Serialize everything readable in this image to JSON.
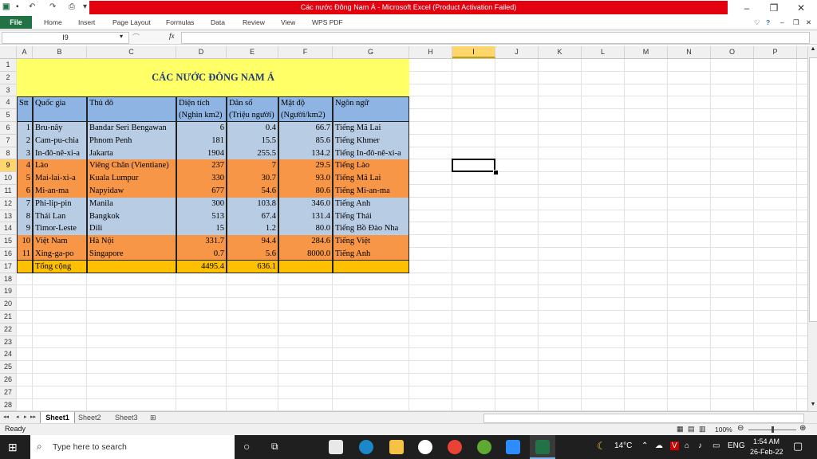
{
  "title_bar": {
    "title": "Các nước Đông Nam Á  -  Microsoft Excel (Product Activation Failed)"
  },
  "ribbon_tabs": [
    "File",
    "Home",
    "Insert",
    "Page Layout",
    "Formulas",
    "Data",
    "Review",
    "View",
    "WPS PDF"
  ],
  "formula_bar": {
    "name_box": "I9",
    "fx": "fx",
    "formula": ""
  },
  "columns": [
    "A",
    "B",
    "C",
    "D",
    "E",
    "F",
    "G",
    "H",
    "I",
    "J",
    "K",
    "L",
    "M",
    "N",
    "O",
    "P"
  ],
  "rows": [
    "1",
    "2",
    "3",
    "4",
    "5",
    "6",
    "7",
    "8",
    "9",
    "10",
    "11",
    "12",
    "13",
    "14",
    "15",
    "16",
    "17",
    "18",
    "19",
    "20",
    "21",
    "22",
    "23",
    "24",
    "25",
    "26",
    "27",
    "28"
  ],
  "selected_cell": {
    "column": "I",
    "row": "9"
  },
  "table": {
    "title": "CÁC NƯỚC ĐÔNG NAM Á",
    "headers": {
      "stt": "Stt",
      "country": "Quốc gia",
      "capital": "Thủ đô",
      "area_1": "Diện tích",
      "area_2": "(Nghìn km2)",
      "pop_1": "Dân số",
      "pop_2": "(Triệu người)",
      "density_1": "Mật độ",
      "density_2": "(Người/km2)",
      "language": "Ngôn ngữ"
    },
    "rows": [
      {
        "stt": "1",
        "country": "Bru-nây",
        "capital": "Bandar Seri Bengawan",
        "area": "6",
        "pop": "0.4",
        "density": "66.7",
        "language": "Tiếng Mã Lai",
        "color": "#b8cce4"
      },
      {
        "stt": "2",
        "country": "Cam-pu-chia",
        "capital": "Phnom Penh",
        "area": "181",
        "pop": "15.5",
        "density": "85.6",
        "language": "Tiếng Khmer",
        "color": "#b8cce4"
      },
      {
        "stt": "3",
        "country": "In-đô-nê-xi-a",
        "capital": "Jakarta",
        "area": "1904",
        "pop": "255.5",
        "density": "134.2",
        "language": "Tiếng In-đô-nê-xi-a",
        "color": "#b8cce4"
      },
      {
        "stt": "4",
        "country": "Lào",
        "capital": "Viêng Chăn (Vientiane)",
        "area": "237",
        "pop": "7",
        "density": "29.5",
        "language": "Tiếng Lào",
        "color": "#f79646"
      },
      {
        "stt": "5",
        "country": "Mai-lai-xi-a",
        "capital": "Kuala Lumpur",
        "area": "330",
        "pop": "30.7",
        "density": "93.0",
        "language": "Tiếng Mã Lai",
        "color": "#f79646"
      },
      {
        "stt": "6",
        "country": "Mi-an-ma",
        "capital": "Napyidaw",
        "area": "677",
        "pop": "54.6",
        "density": "80.6",
        "language": "Tiếng Mi-an-ma",
        "color": "#f79646"
      },
      {
        "stt": "7",
        "country": "Phi-lip-pin",
        "capital": "Manila",
        "area": "300",
        "pop": "103.8",
        "density": "346.0",
        "language": "Tiếng Anh",
        "color": "#b8cce4"
      },
      {
        "stt": "8",
        "country": "Thái Lan",
        "capital": "Bangkok",
        "area": "513",
        "pop": "67.4",
        "density": "131.4",
        "language": "Tiếng Thái",
        "color": "#b8cce4"
      },
      {
        "stt": "9",
        "country": "Timor-Leste",
        "capital": "Dili",
        "area": "15",
        "pop": "1.2",
        "density": "80.0",
        "language": "Tiếng Bồ Đào Nha",
        "color": "#b8cce4"
      },
      {
        "stt": "10",
        "country": "Việt Nam",
        "capital": "Hà Nội",
        "area": "331.7",
        "pop": "94.4",
        "density": "284.6",
        "language": "Tiếng Việt",
        "color": "#f79646"
      },
      {
        "stt": "11",
        "country": "Xing-ga-po",
        "capital": "Singapore",
        "area": "0.7",
        "pop": "5.6",
        "density": "8000.0",
        "language": "Tiếng Anh",
        "color": "#f79646"
      }
    ],
    "total": {
      "label": "Tổng cộng",
      "area": "4495.4",
      "pop": "636.1"
    }
  },
  "colors": {
    "title_fill": "#ffff66",
    "header_fill": "#8db4e2",
    "blue_fill": "#b8cce4",
    "orange_fill": "#f79646",
    "total_fill": "#ffc000",
    "excel_green": "#217346",
    "title_red": "#e3000f"
  },
  "sheet_tabs": [
    "Sheet1",
    "Sheet2",
    "Sheet3"
  ],
  "status": {
    "text": "Ready",
    "zoom": "100%"
  },
  "taskbar": {
    "search_placeholder": "Type here to search",
    "temperature": "14°C",
    "language": "ENG",
    "time": "1:54 AM",
    "date": "26-Feb-22"
  }
}
